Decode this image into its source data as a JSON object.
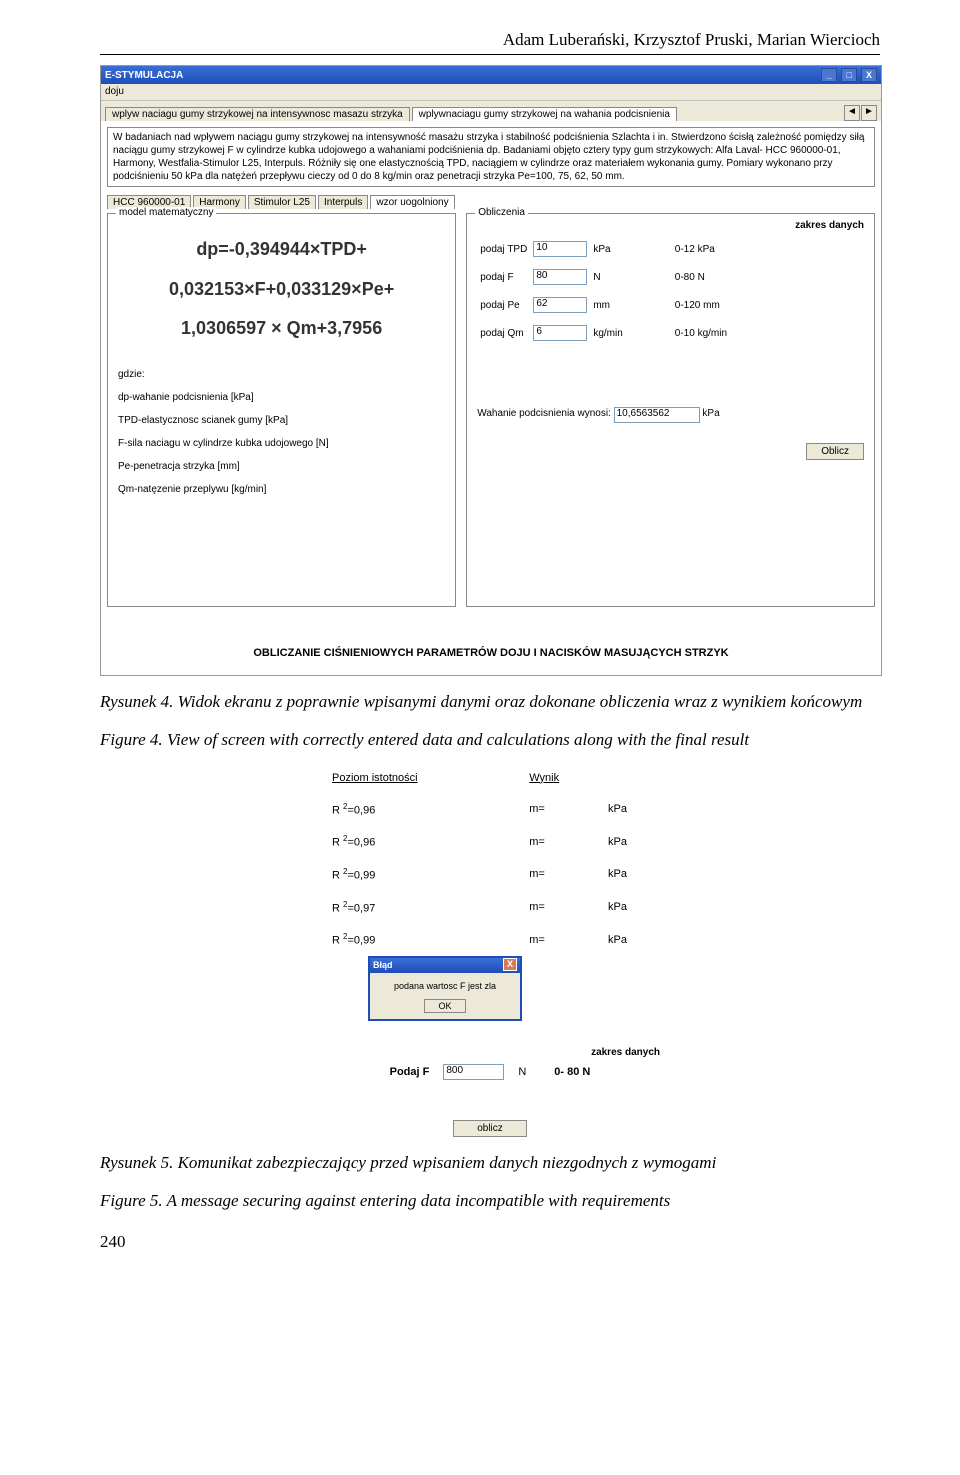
{
  "header": {
    "authors": "Adam Luberański, Krzysztof Pruski, Marian Wiercioch"
  },
  "screenshot1": {
    "title": "E-STYMULACJA",
    "menu": "doju",
    "tabs": {
      "t1": "wplyw naciagu gumy strzykowej na intensywnosc masazu strzyka",
      "t2": "wplywnaciagu gumy strzykowej na wahania podcisnienia"
    },
    "desc": "W badaniach nad wpływem naciągu gumy strzykowej na intensywność masażu strzyka i stabilność podciśnienia Szlachta i in. Stwierdzono ścisłą zależność pomiędzy siłą naciągu gumy strzykowej F w cylindrze kubka udojowego a wahaniami podciśnienia dp. Badaniami objęto cztery typy gum strzykowych: Alfa Laval- HCC 960000-01, Harmony, Westfalia-Stimulor L25, Interpuls. Różniły się one elastycznością TPD, naciągiem w cylindrze oraz materiałem wykonania gumy. Pomiary wykonano przy podciśnieniu 50 kPa dla natężeń przepływu cieczy od 0 do 8 kg/min oraz penetracji strzyka Pe=100, 75, 62, 50 mm.",
    "innertabs": {
      "t1": "HCC 960000-01",
      "t2": "Harmony",
      "t3": "Stimulor L25",
      "t4": "Interpuls",
      "t5": "wzor uogolniony"
    },
    "leftpanel": {
      "legend": "model matematyczny",
      "formula_l1": "dp=-0,394944×TPD+",
      "formula_l2": "0,032153×F+0,033129×Pe+",
      "formula_l3": "1,0306597 × Qm+3,7956",
      "gdzie": "gdzie:",
      "defs": {
        "d1": "dp-wahanie podcisnienia [kPa]",
        "d2": "TPD-elastycznosc scianek gumy [kPa]",
        "d3": "F-sila naciagu w cylindrze kubka udojowego [N]",
        "d4": "Pe-penetracja strzyka [mm]",
        "d5": "Qm-natęzenie przeplywu [kg/min]"
      }
    },
    "rightpanel": {
      "legend": "Obliczenia",
      "zakres": "zakres danych",
      "rows": [
        {
          "label": "podaj TPD",
          "val": "10",
          "unit": "kPa",
          "range": "0-12 kPa"
        },
        {
          "label": "podaj F",
          "val": "80",
          "unit": "N",
          "range": "0-80 N"
        },
        {
          "label": "podaj Pe",
          "val": "62",
          "unit": "mm",
          "range": "0-120 mm"
        },
        {
          "label": "podaj Qm",
          "val": "6",
          "unit": "kg/min",
          "range": "0-10 kg/min"
        }
      ],
      "result_label": "Wahanie podcisnienia wynosi:",
      "result_val": "10,6563562",
      "result_unit": "kPa",
      "btn": "Oblicz"
    },
    "bottomtitle": "OBLICZANIE CIŚNIENIOWYCH PARAMETRÓW DOJU I NACISKÓW MASUJĄCYCH STRZYK"
  },
  "caption1": {
    "pl": "Rysunek 4. Widok ekranu z poprawnie wpisanymi danymi oraz dokonane obliczenia wraz z wynikiem końcowym",
    "en": "Figure 4. View of screen with correctly entered data and calculations along with the final result"
  },
  "screenshot2": {
    "hdr1": "Poziom istotności",
    "hdr2": "Wynik",
    "rows": [
      {
        "r": "0,96",
        "m": "m=",
        "u": "kPa"
      },
      {
        "r": "0,96",
        "m": "m=",
        "u": "kPa"
      },
      {
        "r": "0,99",
        "m": "m=",
        "u": "kPa"
      },
      {
        "r": "0,97",
        "m": "m=",
        "u": "kPa"
      },
      {
        "r": "0,99",
        "m": "m=",
        "u": "kPa"
      }
    ],
    "rprefix": "R",
    "requals": "=",
    "sup": "2",
    "error": {
      "title": "Błąd",
      "msg": "podana wartosc F jest zla",
      "ok": "OK"
    },
    "zakres": "zakres danych",
    "podajF": "Podaj F",
    "val": "800",
    "unit": "N",
    "range": "0- 80 N",
    "btn": "oblicz"
  },
  "caption2": {
    "pl": "Rysunek 5. Komunikat zabezpieczający przed wpisaniem danych niezgodnych z wymogami",
    "en": "Figure 5. A message securing against entering data incompatible with requirements"
  },
  "pnum": "240"
}
